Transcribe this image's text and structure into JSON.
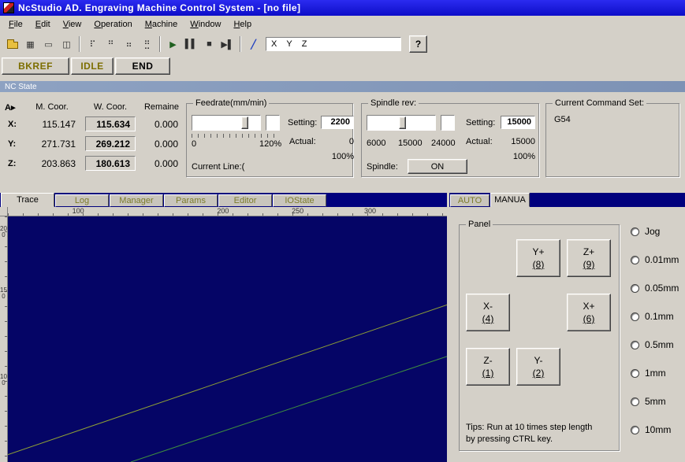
{
  "colors": {
    "titlebar_blue": "#1a1ae0",
    "nc_state_bar": "#8799ba",
    "tabstrip_navy": "#00007d",
    "canvas_navy": "#050566",
    "inactive_tab_text": "#7c7c2a",
    "mode_button_text": "#7c6e00"
  },
  "window": {
    "title": "NcStudio AD. Engraving Machine Control System - [no file]"
  },
  "menu": {
    "items": [
      {
        "label": "File"
      },
      {
        "label": "Edit"
      },
      {
        "label": "View"
      },
      {
        "label": "Operation"
      },
      {
        "label": "Machine"
      },
      {
        "label": "Window"
      },
      {
        "label": "Help"
      }
    ]
  },
  "toolbar": {
    "icons": [
      {
        "name": "open-folder-icon",
        "glyph": "css-folder"
      },
      {
        "name": "save-icon",
        "glyph": "▦"
      },
      {
        "name": "screen-icon",
        "glyph": "▭"
      },
      {
        "name": "windows-icon",
        "glyph": "◫"
      },
      {
        "name": "antenna-icon",
        "glyph": "⠏"
      },
      {
        "name": "dots-grid-icon",
        "glyph": "⠛"
      },
      {
        "name": "pin-icon",
        "glyph": "⠶"
      },
      {
        "name": "download-icon",
        "glyph": "⣛"
      },
      {
        "name": "start-icon",
        "glyph": "▶"
      },
      {
        "name": "pause-icon",
        "glyph": "▌▌"
      },
      {
        "name": "stop-icon",
        "glyph": "■"
      },
      {
        "name": "step-icon",
        "glyph": "▶▌"
      },
      {
        "name": "pen-icon",
        "glyph": "╱"
      }
    ],
    "axis_combo_value": "X    Y    Z",
    "help_label": "?"
  },
  "mode_buttons": [
    {
      "label": "BKREF"
    },
    {
      "label": "IDLE"
    },
    {
      "label": "END"
    }
  ],
  "nc_state_bar": {
    "label": "NC State"
  },
  "coords": {
    "corner_label": "A",
    "corner_arrow": "▸",
    "headers": [
      "M. Coor.",
      "W. Coor.",
      "Remaine"
    ],
    "rows": [
      {
        "axis": "X:",
        "m": "115.147",
        "w": "115.634",
        "r": "0.000"
      },
      {
        "axis": "Y:",
        "m": "271.731",
        "w": "269.212",
        "r": "0.000"
      },
      {
        "axis": "Z:",
        "m": "203.863",
        "w": "180.613",
        "r": "0.000"
      }
    ]
  },
  "feedrate": {
    "title": "Feedrate(mm/min)",
    "setting_label": "Setting:",
    "setting_value": "2200",
    "actual_label": "Actual:",
    "actual_value": "0",
    "scale_min": "0",
    "scale_max": "120%",
    "percent": "100%",
    "current_line_label": "Current Line:("
  },
  "spindle": {
    "title": "Spindle rev:",
    "setting_label": "Setting:",
    "setting_value": "15000",
    "actual_label": "Actual:",
    "actual_value": "15000",
    "scale_labels": [
      "6000",
      "15000",
      "24000"
    ],
    "percent": "100%",
    "spindle_label": "Spindle:",
    "on_button": "ON"
  },
  "command_set": {
    "title": "Current Command Set:",
    "value": "G54"
  },
  "trace_tabs": [
    {
      "label": "Trace",
      "active": true
    },
    {
      "label": "Log",
      "active": false
    },
    {
      "label": "Manager",
      "active": false
    },
    {
      "label": "Params",
      "active": false
    },
    {
      "label": "Editor",
      "active": false
    },
    {
      "label": "IOState",
      "active": false
    }
  ],
  "trace": {
    "h_ruler_labels": [
      "100",
      "200",
      "250",
      "300"
    ],
    "v_ruler_labels": [
      "200",
      "150",
      "100"
    ],
    "lines": [
      {
        "color": "#8fa035"
      },
      {
        "color": "#3f8f3f"
      }
    ]
  },
  "panel_tabs": [
    {
      "label": "AUTO",
      "active": false
    },
    {
      "label": "MANUA",
      "active": true
    }
  ],
  "jog": {
    "group_title": "Panel",
    "buttons": [
      {
        "label": "Y+",
        "key": "(8)"
      },
      {
        "label": "Z+",
        "key": "(9)"
      },
      {
        "label": "X-",
        "key": "(4)"
      },
      {
        "label": "X+",
        "key": "(6)"
      },
      {
        "label": "Z-",
        "key": "(1)"
      },
      {
        "label": "Y-",
        "key": "(2)"
      }
    ],
    "tips_line1": "Tips: Run at 10 times step length",
    "tips_line2": "by pressing CTRL key."
  },
  "steps": {
    "options": [
      "Jog",
      "0.01mm",
      "0.05mm",
      "0.1mm",
      "0.5mm",
      "1mm",
      "5mm",
      "10mm"
    ]
  }
}
